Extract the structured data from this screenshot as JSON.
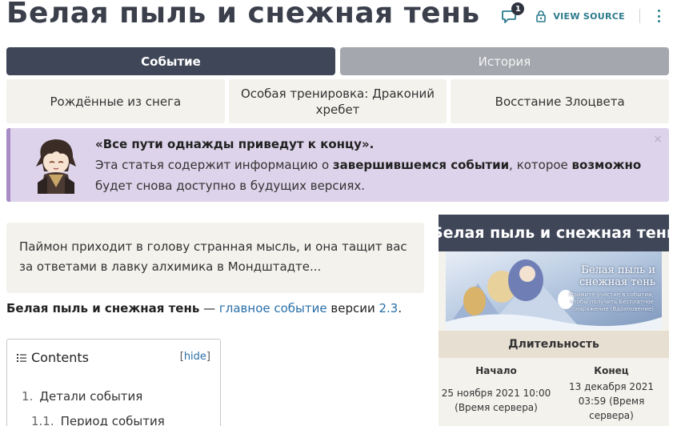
{
  "page": {
    "title": "Белая пыль и снежная тень"
  },
  "actions": {
    "comment_count": "1",
    "view_source_label": "VIEW SOURCE"
  },
  "tabs": [
    {
      "label": "Событие",
      "active": true
    },
    {
      "label": "История",
      "active": false
    }
  ],
  "subtabs": [
    {
      "label": "Рождённые из снега"
    },
    {
      "label": "Особая тренировка: Драконий хребет"
    },
    {
      "label": "Восстание Злоцвета"
    }
  ],
  "notice": {
    "title": "«Все пути однажды приведут к концу».",
    "text_1": "Эта статья содержит информацию о ",
    "text_bold_1": "завершившемся событии",
    "text_2": ", которое ",
    "text_bold_2": "возможно",
    "text_3": " будет снова доступно в будущих версиях.",
    "close_symbol": "×"
  },
  "quote": {
    "text": "Паймон приходит в голову странная мысль, и она тащит вас за ответами в лавку алхимика в Мондштадте..."
  },
  "lead": {
    "bold": "Белая пыль и снежная тень",
    "dash": " — ",
    "link_1": "главное событие",
    "middle": " версии ",
    "link_2": "2.3",
    "end": "."
  },
  "toc": {
    "title": "Contents",
    "hide_open": "[",
    "hide_label": "hide",
    "hide_close": "]",
    "items": [
      {
        "num": "1.",
        "label": "Детали события"
      },
      {
        "num": "1.1.",
        "label": "Период события"
      }
    ]
  },
  "infobox": {
    "title": "Белая пыль и снежная тень",
    "image_title_line1": "Белая пыль и",
    "image_title_line2": "снежная тень",
    "image_subtitle": "Примите участие в событии, чтобы получить Бесплатное снаряжение (Вдохновение)",
    "section": "Длительность",
    "start_header": "Начало",
    "start_line1": "25 ноября 2021 10:00",
    "start_line2": "(Время сервера)",
    "end_header": "Конец",
    "end_line1": "13 декабря 2021",
    "end_line2": "03:59 (Время",
    "end_line3": "сервера)"
  },
  "colors": {
    "tab_active": "#3f4658",
    "tab_inactive": "#a4a7ad",
    "notice_bg": "#ddd3ea",
    "notice_border": "#a88bc7",
    "link": "#2a6fa8",
    "accent_teal": "#2b7a8c"
  },
  "icons": [
    "comment-icon",
    "lock-icon",
    "more-vertical-icon",
    "list-icon",
    "close-icon"
  ]
}
